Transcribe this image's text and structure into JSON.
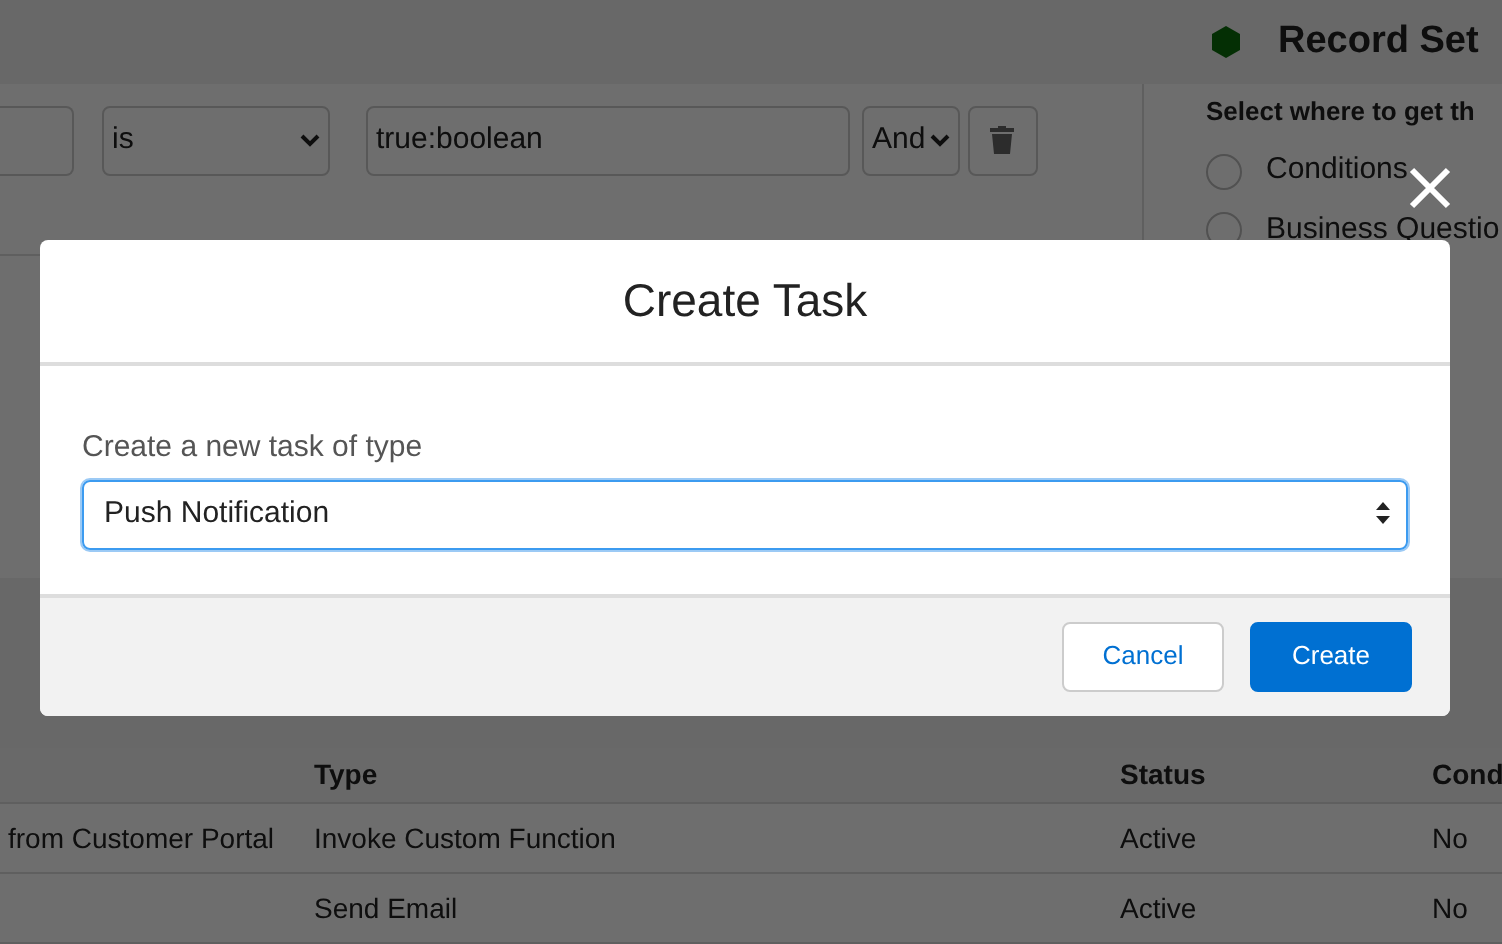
{
  "background": {
    "panel_title": "Record Set",
    "filter": {
      "operator": "is",
      "value": "true:boolean",
      "join": "And"
    },
    "source_prompt": "Select where to get th",
    "sources": [
      {
        "label": "Conditions",
        "selected": false
      },
      {
        "label": "Business Questio",
        "selected": false
      }
    ],
    "table": {
      "columns": [
        "",
        "Type",
        "Status",
        "Cond"
      ],
      "rows": [
        [
          "from Customer Portal",
          "Invoke Custom Function",
          "Active",
          "No"
        ],
        [
          "",
          "Send Email",
          "Active",
          "No"
        ]
      ]
    }
  },
  "modal": {
    "title": "Create Task",
    "field_label": "Create a new task of type",
    "task_type": "Push Notification",
    "buttons": [
      {
        "label": "Cancel",
        "kind": "secondary"
      },
      {
        "label": "Create",
        "kind": "primary"
      }
    ]
  }
}
